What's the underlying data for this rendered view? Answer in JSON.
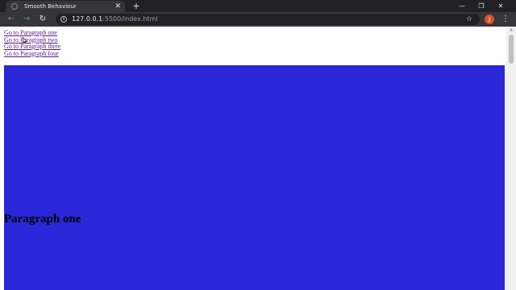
{
  "browser": {
    "tab_title": "Smooth Behaviour",
    "tab_close_icon": "close-icon",
    "new_tab_icon": "plus-icon",
    "url_host": "127.0.0.1",
    "url_rest": ":5500/index.html",
    "avatar_initial": "J",
    "window_controls": [
      "minimize-icon",
      "restore-icon",
      "close-icon"
    ]
  },
  "page": {
    "links": [
      "Go to Paragraph one",
      "Go to Paragraph two",
      "Go to Paragraph three",
      "Go to Paragraph four"
    ],
    "section_heading": "Paragraph one"
  },
  "colors": {
    "section_background": "#2a27d8",
    "link_color": "#551a8b",
    "chrome_dark": "#202124",
    "toolbar": "#35363a",
    "avatar": "#d8532a"
  }
}
